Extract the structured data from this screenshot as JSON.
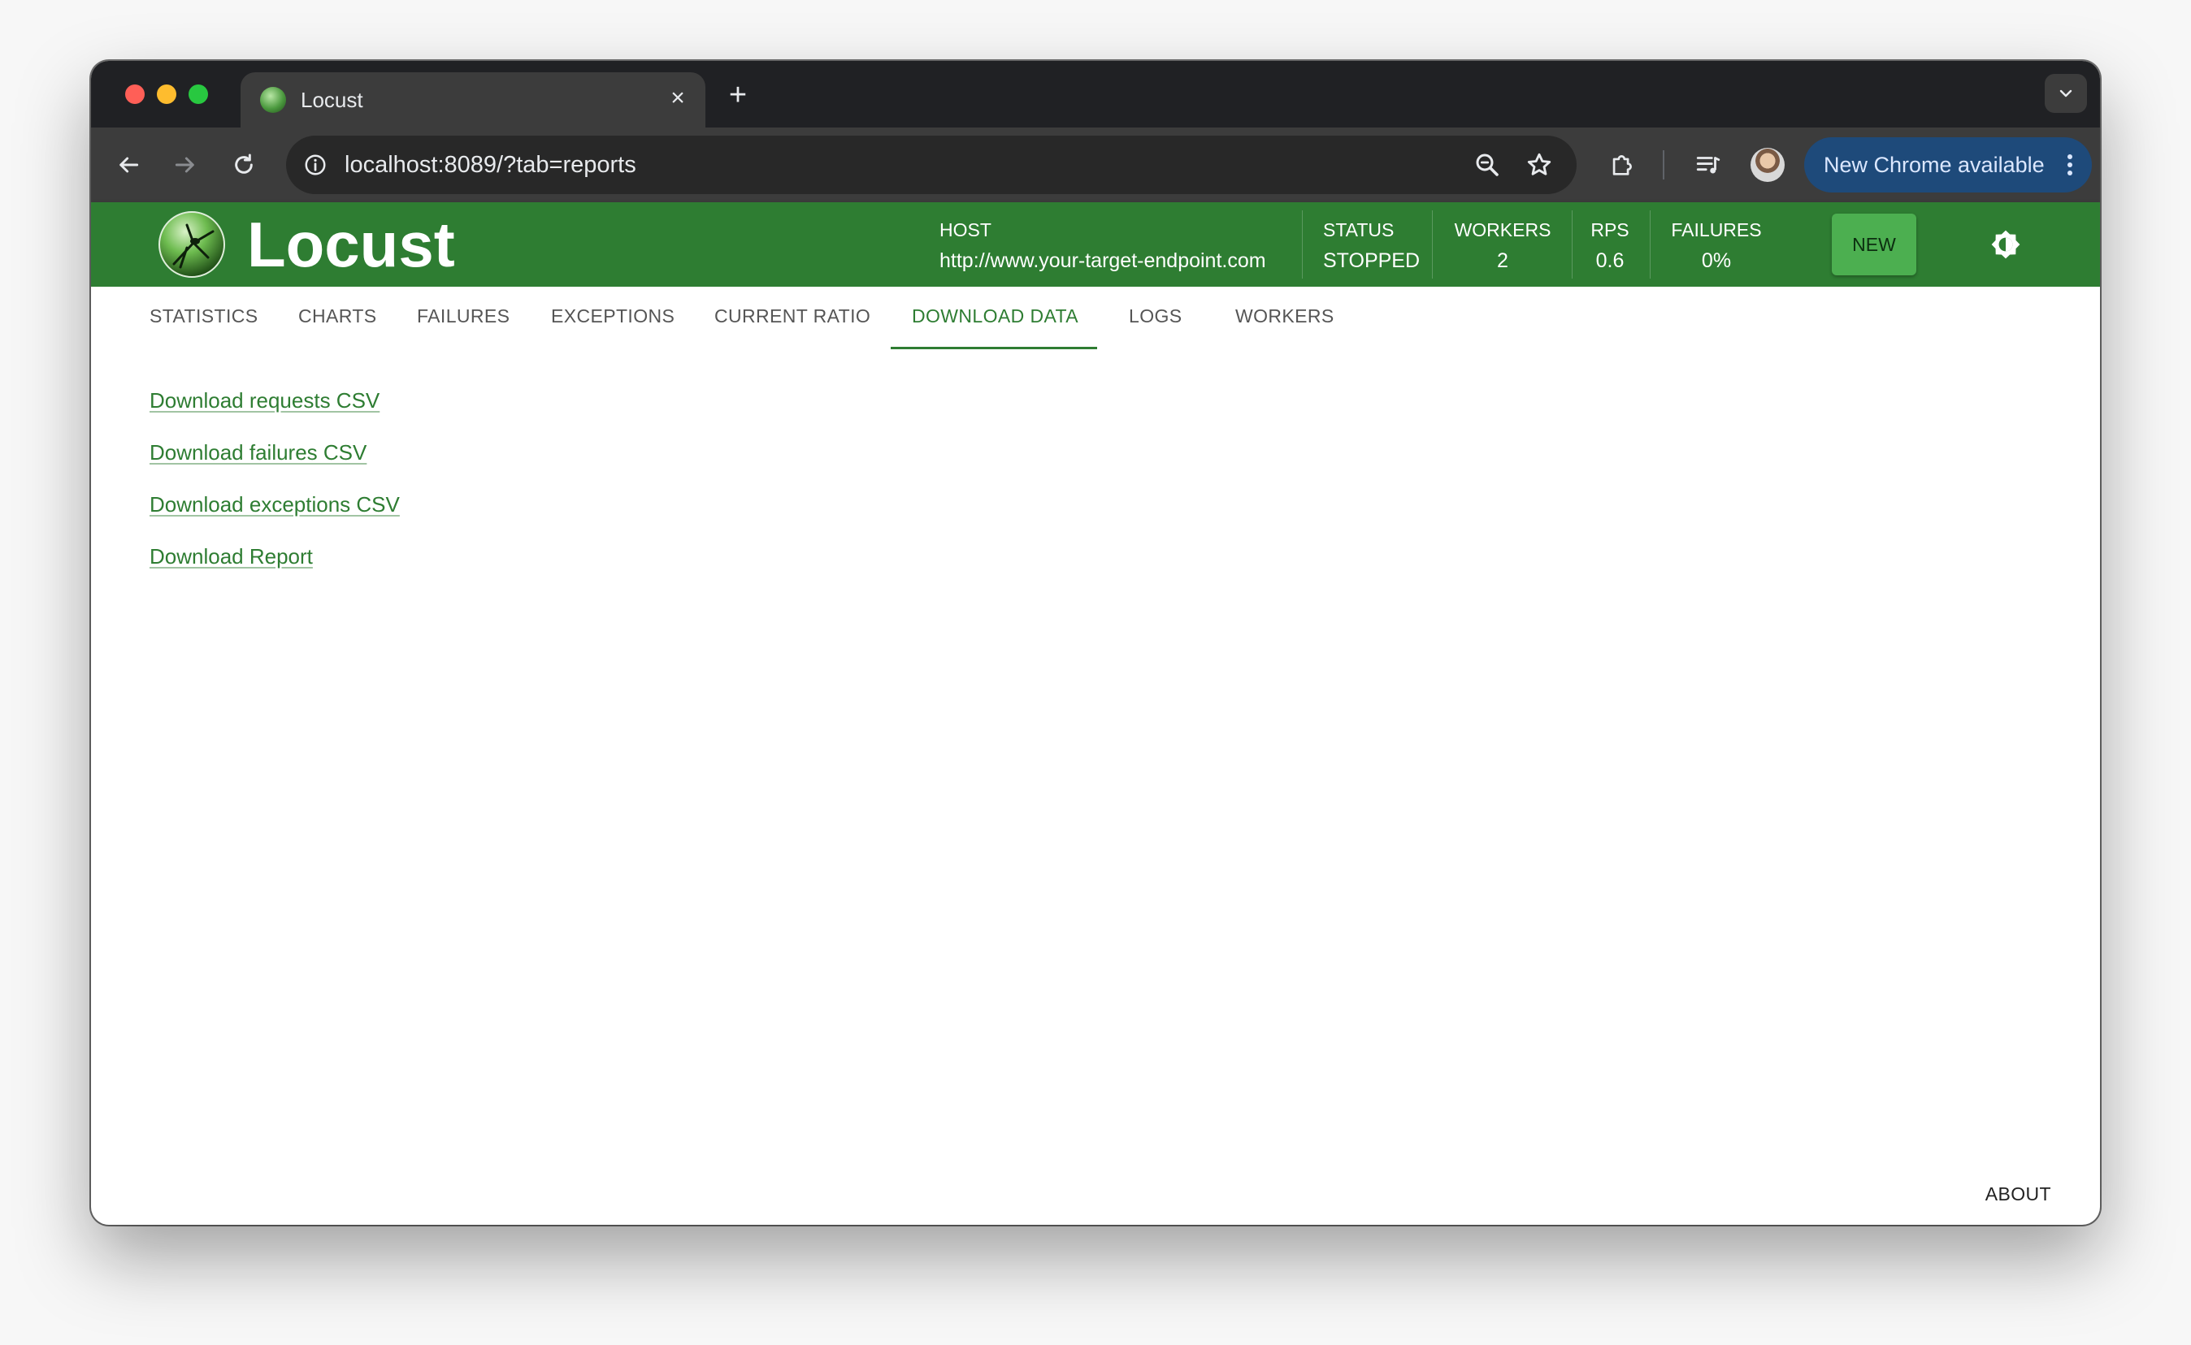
{
  "browser": {
    "tab_title": "Locust",
    "url": "localhost:8089/?tab=reports",
    "update_button_label": "New Chrome available",
    "icons": [
      "back-arrow-icon",
      "forward-arrow-icon",
      "reload-icon",
      "site-info-icon",
      "zoom-icon",
      "bookmark-star-icon",
      "extensions-puzzle-icon",
      "media-playlist-icon",
      "profile-avatar",
      "kebab-menu-icon",
      "tab-search-chevron-icon"
    ]
  },
  "header": {
    "logo_text": "Locust",
    "host_label": "HOST",
    "host_value": "http://www.your-target-endpoint.com",
    "status_label": "STATUS",
    "status_value": "STOPPED",
    "workers_label": "WORKERS",
    "workers_value": "2",
    "rps_label": "RPS",
    "rps_value": "0.6",
    "failures_label": "FAILURES",
    "failures_value": "0%",
    "new_button": "NEW",
    "brand_color": "#2e7d32"
  },
  "tabs": [
    {
      "label": "STATISTICS",
      "active": false
    },
    {
      "label": "CHARTS",
      "active": false
    },
    {
      "label": "FAILURES",
      "active": false
    },
    {
      "label": "EXCEPTIONS",
      "active": false
    },
    {
      "label": "CURRENT RATIO",
      "active": false
    },
    {
      "label": "DOWNLOAD DATA",
      "active": true
    },
    {
      "label": "LOGS",
      "active": false
    },
    {
      "label": "WORKERS",
      "active": false
    }
  ],
  "downloads": [
    {
      "label": "Download requests CSV"
    },
    {
      "label": "Download failures CSV"
    },
    {
      "label": "Download exceptions CSV"
    },
    {
      "label": "Download Report"
    }
  ],
  "footer": {
    "about_label": "ABOUT"
  }
}
